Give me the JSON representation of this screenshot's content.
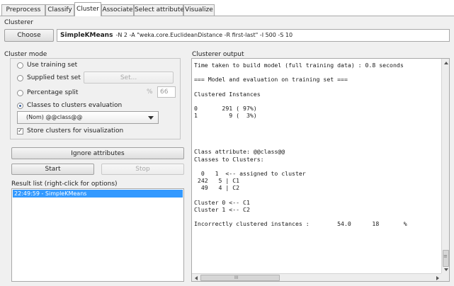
{
  "tabs": [
    {
      "label": "Preprocess"
    },
    {
      "label": "Classify"
    },
    {
      "label": "Cluster"
    },
    {
      "label": "Associate"
    },
    {
      "label": "Select attributes"
    },
    {
      "label": "Visualize"
    }
  ],
  "active_tab": "Cluster",
  "clusterer": {
    "section_label": "Clusterer",
    "choose_label": "Choose",
    "name": "SimpleKMeans",
    "options": "-N 2 -A \"weka.core.EuclideanDistance -R first-last\" -I 500 -S 10"
  },
  "cluster_mode": {
    "section_label": "Cluster mode",
    "use_training_set": "Use training set",
    "supplied_test_set": "Supplied test set",
    "set_button": "Set...",
    "percentage_split": "Percentage split",
    "percent_symbol": "%",
    "percent_value": "66",
    "classes_to_clusters": "Classes to clusters evaluation",
    "class_select": "(Nom) @@class@@",
    "store_clusters": "Store clusters for visualization",
    "selected": "classes_to_clusters",
    "store_clusters_checked": true
  },
  "ignore_attributes_label": "Ignore attributes",
  "start_label": "Start",
  "stop_label": "Stop",
  "result_list": {
    "label": "Result list (right-click for options)",
    "items": [
      "22:49:59 - SimpleKMeans"
    ]
  },
  "output": {
    "label": "Clusterer output",
    "lines": [
      "Time taken to build model (full training data) : 0.8 seconds",
      "",
      "=== Model and evaluation on training set ===",
      "",
      "Clustered Instances",
      "",
      "0       291 ( 97%)",
      "1         9 (  3%)",
      "",
      "",
      "",
      "",
      "Class attribute: @@class@@",
      "Classes to Clusters:",
      "",
      "  0   1  <-- assigned to cluster",
      " 242   5 | C1",
      "  49   4 | C2",
      "",
      "Cluster 0 <-- C1",
      "Cluster 1 <-- C2",
      "",
      "Incorrectly clustered instances :        54.0      18       %"
    ],
    "hscroll_thumb_label": "III"
  },
  "colors": {
    "selection": "#3399ff",
    "panel_bg": "#f0f0f0",
    "border": "#a9a9a9"
  }
}
